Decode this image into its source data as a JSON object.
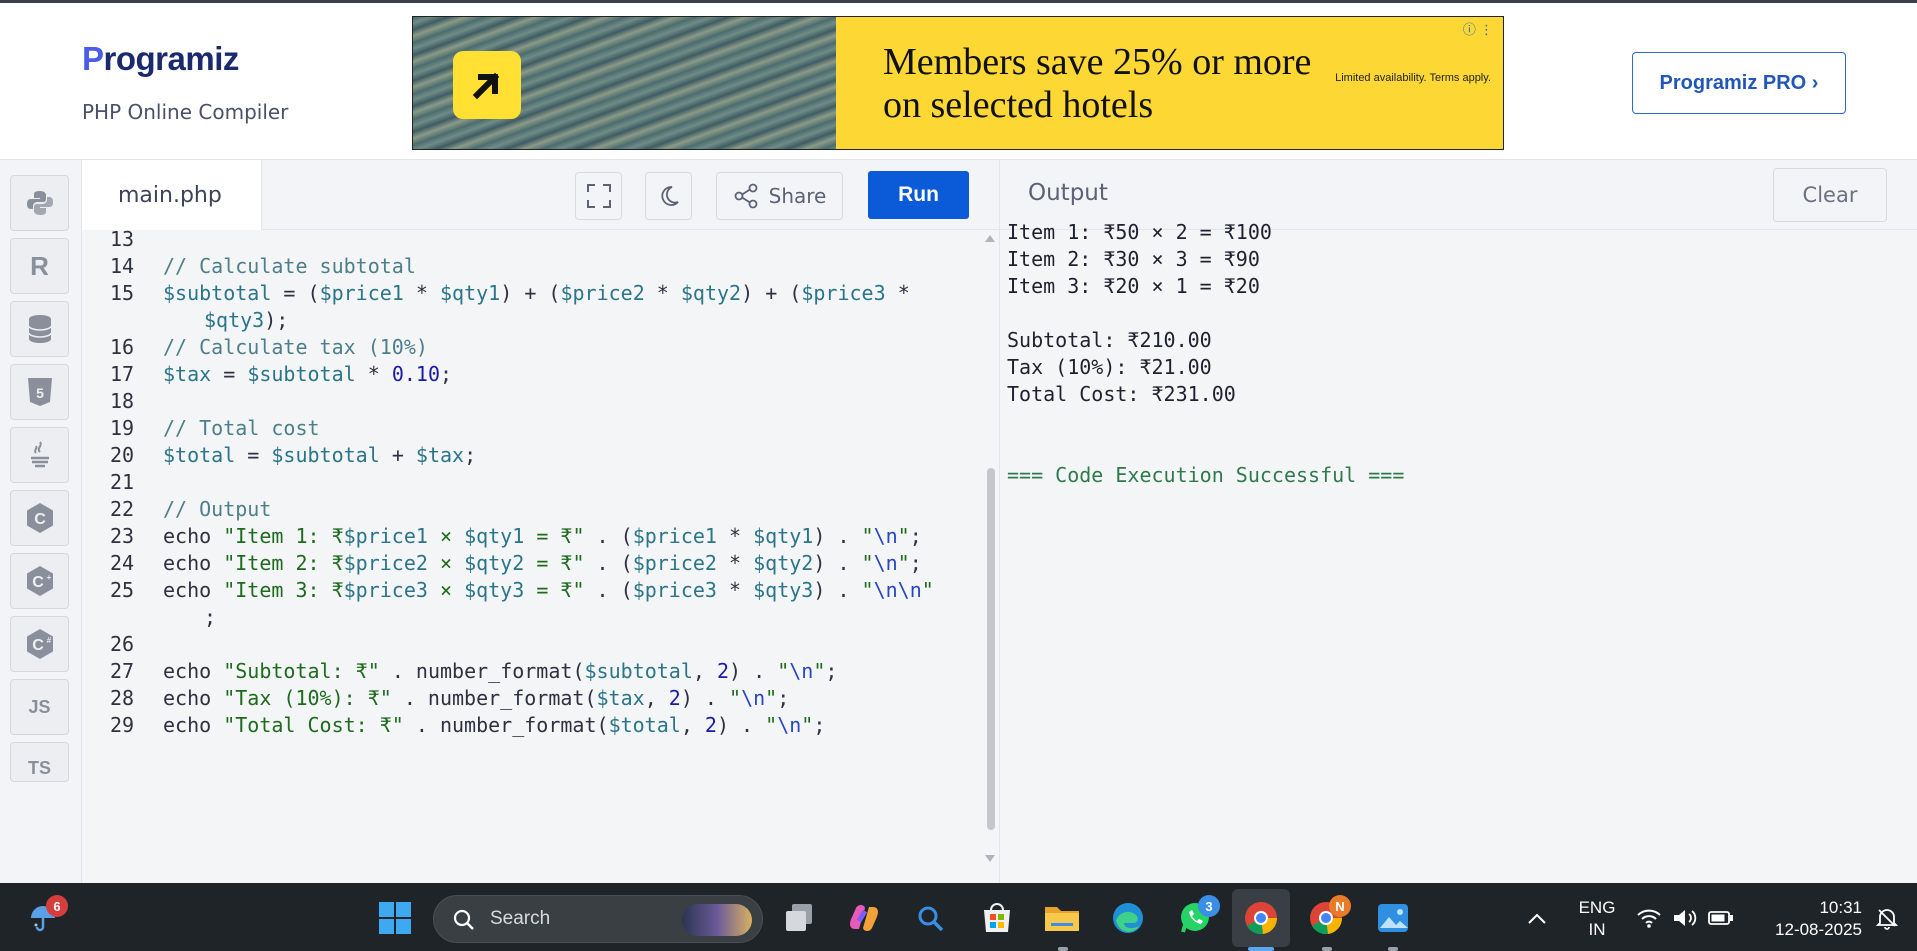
{
  "header": {
    "logo_text": "Programiz",
    "subtitle": "PHP Online Compiler",
    "ad": {
      "headline": "Members save 25% or more on selected hotels",
      "fineprint": "Limited availability. Terms apply.",
      "info_icon": "info-icon",
      "arrow_icon": "arrow-up-right-icon"
    },
    "pro_button": "Programiz PRO ›"
  },
  "sidebar": {
    "items": [
      {
        "name": "python",
        "label": ""
      },
      {
        "name": "r",
        "label": "R"
      },
      {
        "name": "sql",
        "label": ""
      },
      {
        "name": "html",
        "label": "5"
      },
      {
        "name": "java",
        "label": ""
      },
      {
        "name": "c",
        "label": "C"
      },
      {
        "name": "cpp",
        "label": "C"
      },
      {
        "name": "csharp",
        "label": "C"
      },
      {
        "name": "js",
        "label": "JS"
      },
      {
        "name": "ts",
        "label": "TS"
      }
    ]
  },
  "editor": {
    "filename": "main.php",
    "share_label": "Share",
    "run_label": "Run",
    "lines": [
      {
        "n": "13",
        "t": ""
      },
      {
        "n": "14",
        "t": "// Calculate subtotal"
      },
      {
        "n": "15",
        "t": "$subtotal = ($price1 * $qty1) + ($price2 * $qty2) + ($price3 *"
      },
      {
        "n": "",
        "t": "    $qty3);"
      },
      {
        "n": "16",
        "t": "// Calculate tax (10%)"
      },
      {
        "n": "17",
        "t": "$tax = $subtotal * 0.10;"
      },
      {
        "n": "18",
        "t": ""
      },
      {
        "n": "19",
        "t": "// Total cost"
      },
      {
        "n": "20",
        "t": "$total = $subtotal + $tax;"
      },
      {
        "n": "21",
        "t": ""
      },
      {
        "n": "22",
        "t": "// Output"
      },
      {
        "n": "23",
        "t": "echo \"Item 1: ₹$price1 × $qty1 = ₹\" . ($price1 * $qty1) . \"\\n\";"
      },
      {
        "n": "24",
        "t": "echo \"Item 2: ₹$price2 × $qty2 = ₹\" . ($price2 * $qty2) . \"\\n\";"
      },
      {
        "n": "25",
        "t": "echo \"Item 3: ₹$price3 × $qty3 = ₹\" . ($price3 * $qty3) . \"\\n\\n\""
      },
      {
        "n": "",
        "t": "    ;"
      },
      {
        "n": "26",
        "t": ""
      },
      {
        "n": "27",
        "t": "echo \"Subtotal: ₹\" . number_format($subtotal, 2) . \"\\n\";"
      },
      {
        "n": "28",
        "t": "echo \"Tax (10%): ₹\" . number_format($tax, 2) . \"\\n\";"
      },
      {
        "n": "29",
        "t": "echo \"Total Cost: ₹\" . number_format($total, 2) . \"\\n\";"
      }
    ]
  },
  "output": {
    "title": "Output",
    "clear_label": "Clear",
    "lines": [
      "Item 1: ₹50 × 2 = ₹100",
      "Item 2: ₹30 × 3 = ₹90",
      "Item 3: ₹20 × 1 = ₹20",
      "",
      "Subtotal: ₹210.00",
      "Tax (10%): ₹21.00",
      "Total Cost: ₹231.00",
      "",
      "",
      "=== Code Execution Successful ==="
    ]
  },
  "taskbar": {
    "weather_badge": "6",
    "search_placeholder": "Search",
    "whatsapp_badge": "3",
    "chrome_profile_badge": "N",
    "language_top": "ENG",
    "language_bottom": "IN",
    "time": "10:31",
    "date": "12-08-2025"
  },
  "colors": {
    "run_button": "#0b5bd8",
    "pro_border": "#2b6ccb",
    "ad_yellow": "#fdd835",
    "taskbar": "#1f2428"
  }
}
